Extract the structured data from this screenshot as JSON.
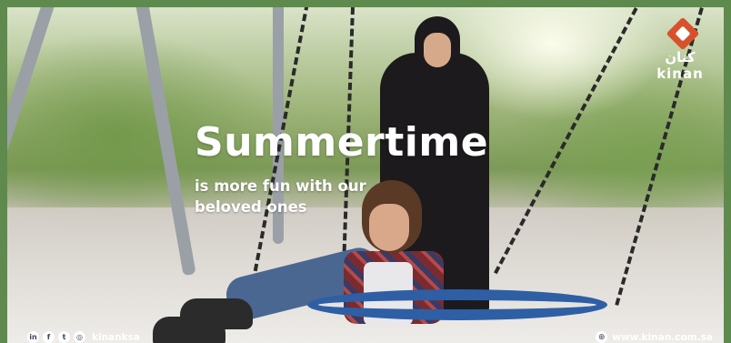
{
  "brand": {
    "name_ar": "كنان",
    "name_en": "kinan"
  },
  "headline": "Summertime",
  "subline": {
    "line1": "is more fun with our",
    "line2": "beloved ones"
  },
  "footer": {
    "social_icons": [
      {
        "name": "linkedin-icon",
        "glyph": "in"
      },
      {
        "name": "facebook-icon",
        "glyph": "f"
      },
      {
        "name": "twitter-icon",
        "glyph": "t"
      },
      {
        "name": "instagram-icon",
        "glyph": "◎"
      }
    ],
    "handle": "kinanksa",
    "website": "www.kinan.com.sa"
  },
  "colors": {
    "frame": "#5f8a4e",
    "logo_accent": "#d9512c",
    "swing_ring": "#2e5fa4"
  }
}
